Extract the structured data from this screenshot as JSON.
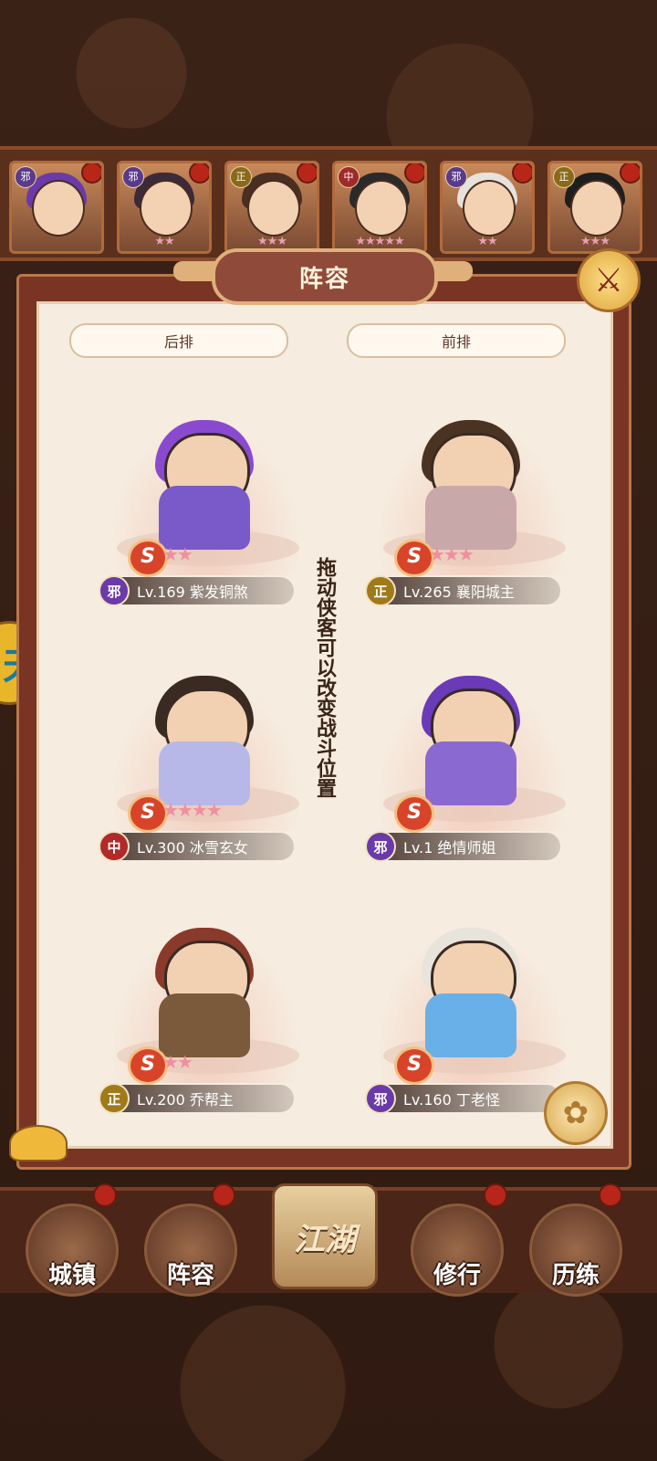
{
  "hero_strip": [
    {
      "faction": "邪",
      "faction_color": "#5a3a8a",
      "hair": "#6a3aa8",
      "stars": ""
    },
    {
      "faction": "邪",
      "faction_color": "#5a3a8a",
      "hair": "#3a2a3a",
      "stars": "★★"
    },
    {
      "faction": "正",
      "faction_color": "#8a6a1a",
      "hair": "#4a2e22",
      "stars": "★★★"
    },
    {
      "faction": "中",
      "faction_color": "#a02a2a",
      "hair": "#2a2a2a",
      "stars": "★★★★★"
    },
    {
      "faction": "邪",
      "faction_color": "#5a3a8a",
      "hair": "#e6e2dc",
      "stars": "★★"
    },
    {
      "faction": "正",
      "faction_color": "#8a6a1a",
      "hair": "#1e1e1e",
      "stars": "★★★"
    }
  ],
  "panel": {
    "title": "阵容",
    "close_icon": "⚔",
    "back_row_label": "后排",
    "front_row_label": "前排",
    "hint": "拖动侠客可以改变战斗位置"
  },
  "slots": [
    {
      "faction": "邪",
      "faction_color": "#6a3aa8",
      "level_name": "Lv.169 紫发铜煞",
      "stars": "★★",
      "hair": "#8a4ad0",
      "body": "#7a5ac8"
    },
    {
      "faction": "正",
      "faction_color": "#a07a1a",
      "level_name": "Lv.265 襄阳城主",
      "stars": "★★★",
      "hair": "#4a3322",
      "body": "#c8a8a8"
    },
    {
      "faction": "中",
      "faction_color": "#b02a2a",
      "level_name": "Lv.300 冰雪玄女",
      "stars": "★★★★",
      "hair": "#3a2a22",
      "body": "#b8b8e8"
    },
    {
      "faction": "邪",
      "faction_color": "#6a3aa8",
      "level_name": "Lv.1 绝情师姐",
      "stars": "",
      "hair": "#6a3ab8",
      "body": "#8a6ad0"
    },
    {
      "faction": "正",
      "faction_color": "#a07a1a",
      "level_name": "Lv.200 乔帮主",
      "stars": "★★",
      "hair": "#8a3a2a",
      "body": "#7a5a3a"
    },
    {
      "faction": "邪",
      "faction_color": "#6a3aa8",
      "level_name": "Lv.160 丁老怪",
      "stars": "",
      "hair": "#e8e4dc",
      "body": "#6ab0e8"
    }
  ],
  "bottom_nav": [
    {
      "label": "城镇"
    },
    {
      "label": "阵容"
    },
    {
      "label": "江湖"
    },
    {
      "label": "修行"
    },
    {
      "label": "历练"
    }
  ],
  "left_peek_glyph": "天"
}
